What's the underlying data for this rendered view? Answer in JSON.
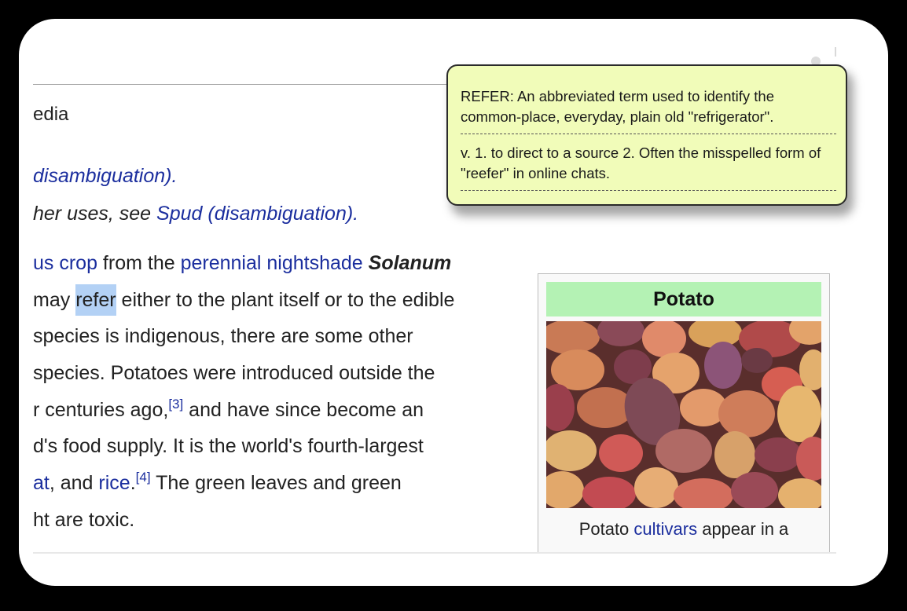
{
  "article": {
    "tagline_fragment": "edia",
    "hatnote1_link": "disambiguation).",
    "hatnote2_text": "her uses, see ",
    "hatnote2_link": "Spud (disambiguation).",
    "lines": {
      "l1_link1": "us crop",
      "l1_text1": " from the ",
      "l1_link2": "perennial nightshade",
      "l1_bold": "Solanum",
      "l2_text1": "may ",
      "l2_highlight": "refer",
      "l2_text2": " either to the plant itself or to the edible",
      "l3": " species is indigenous, there are some other",
      "l4": "species. Potatoes were introduced outside the",
      "l5_text": "r centuries ago,",
      "l5_ref": "[3]",
      "l5_text2": " and have since become an",
      "l6": "d's food supply. It is the world's fourth-largest",
      "l7_link1": "at",
      "l7_text1": ", and ",
      "l7_link2": "rice",
      "l7_text2": ".",
      "l7_ref": "[4]",
      "l7_text3": " The green leaves and green",
      "l8": "ht are toxic."
    }
  },
  "infobox": {
    "title": "Potato",
    "caption_text": "Potato ",
    "caption_link": "cultivars",
    "caption_text2": " appear in a",
    "image_icon": "potatoes-photo"
  },
  "tooltip": {
    "definition1": "REFER:  An abbreviated term used to identify the common-place, everyday, plain old \"refrigerator\".",
    "definition2": "v.   1. to direct to a source  2. Often the misspelled form of \"reefer\" in online chats."
  },
  "colors": {
    "link": "#1b2e9e",
    "highlight": "#b3d1f5",
    "tooltip_bg": "#f1fcb9",
    "infobox_header": "#b4f2b4"
  }
}
